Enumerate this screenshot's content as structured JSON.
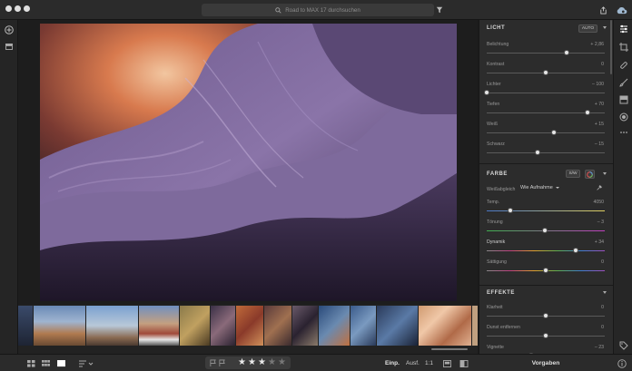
{
  "titlebar": {
    "search_placeholder": "Road to MAX 17 durchsuchen"
  },
  "colors": {
    "panel_bg": "#2c2c2c",
    "accent": "#ffffff",
    "slider_knob": "#e6e6e6"
  },
  "panel": {
    "licht": {
      "title": "LICHT",
      "auto_label": "AUTO",
      "sliders": [
        {
          "label": "Belichtung",
          "value": "+ 2,86",
          "position": 0.68
        },
        {
          "label": "Kontrast",
          "value": "0",
          "position": 0.5
        },
        {
          "label": "Lichter",
          "value": "– 100",
          "position": 0.0
        },
        {
          "label": "Tiefen",
          "value": "+ 70",
          "position": 0.85
        },
        {
          "label": "Weiß",
          "value": "+ 15",
          "position": 0.57
        },
        {
          "label": "Schwarz",
          "value": "– 15",
          "position": 0.43
        }
      ]
    },
    "farbe": {
      "title": "FARBE",
      "sw_label": "S/W",
      "wb_label": "Weißabgleich",
      "wb_value": "Wie Aufnahme",
      "sliders": [
        {
          "label": "Temp.",
          "value": "4050",
          "position": 0.2
        },
        {
          "label": "Tönung",
          "value": "– 3",
          "position": 0.49
        },
        {
          "label": "Dynamik",
          "value": "+ 34",
          "position": 0.75
        },
        {
          "label": "Sättigung",
          "value": "0",
          "position": 0.5
        }
      ]
    },
    "effekte": {
      "title": "EFFEKTE",
      "sliders": [
        {
          "label": "Klarheit",
          "value": "0",
          "position": 0.5
        },
        {
          "label": "Dunst entfernen",
          "value": "0",
          "position": 0.5
        },
        {
          "label": "Vignette",
          "value": "– 23",
          "position": 0.38
        }
      ]
    }
  },
  "bottombar": {
    "rating_value": 3,
    "rating_max": 5,
    "einp_label": "Einp.",
    "ausf_label": "Ausf.",
    "ratio_label": "1:1",
    "vorgaben_label": "Vorgaben"
  },
  "icons": {
    "left": [
      "add-icon",
      "library-icon"
    ],
    "top_right": [
      "share-icon",
      "cloud-icon"
    ],
    "right_column": [
      "edit-sliders-icon",
      "crop-icon",
      "healing-icon",
      "brush-icon",
      "gradient-icon",
      "radial-icon",
      "more-icon",
      "tag-icon",
      "info-icon"
    ]
  }
}
